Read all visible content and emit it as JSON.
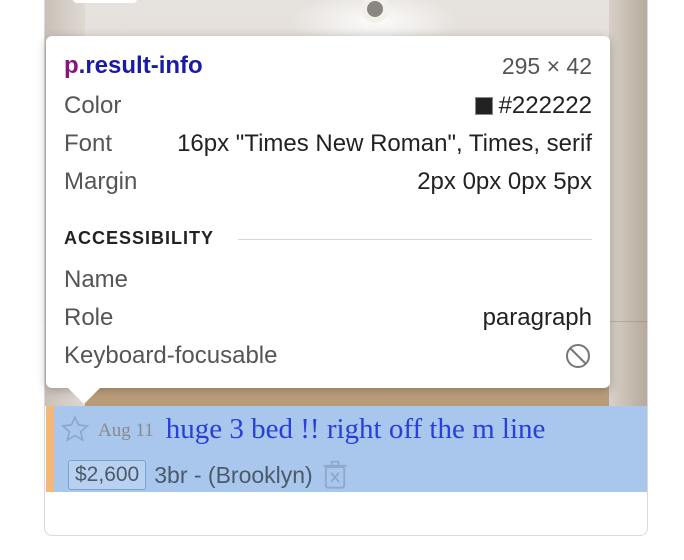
{
  "result": {
    "date": "Aug 11",
    "title": "huge 3 bed !! right off the m line",
    "price": "$2,600",
    "housing": "3br - (Brooklyn)"
  },
  "inspector": {
    "tag": "p",
    "class": ".result-info",
    "dimensions": "295 × 42",
    "color_label": "Color",
    "color_value": "#222222",
    "font_label": "Font",
    "font_value": "16px \"Times New Roman\", Times, serif",
    "margin_label": "Margin",
    "margin_value": "2px 0px 0px 5px",
    "accessibility_heading": "ACCESSIBILITY",
    "name_label": "Name",
    "role_label": "Role",
    "role_value": "paragraph",
    "keyboard_label": "Keyboard-focusable",
    "keyboard_icon": "not-allowed-icon"
  },
  "colors": {
    "highlight": "#a9c6ec",
    "margin_overlay": "#f4b97a",
    "link": "#2a3fd6",
    "selector_tag": "#881280",
    "selector_class": "#1a1aa6"
  }
}
